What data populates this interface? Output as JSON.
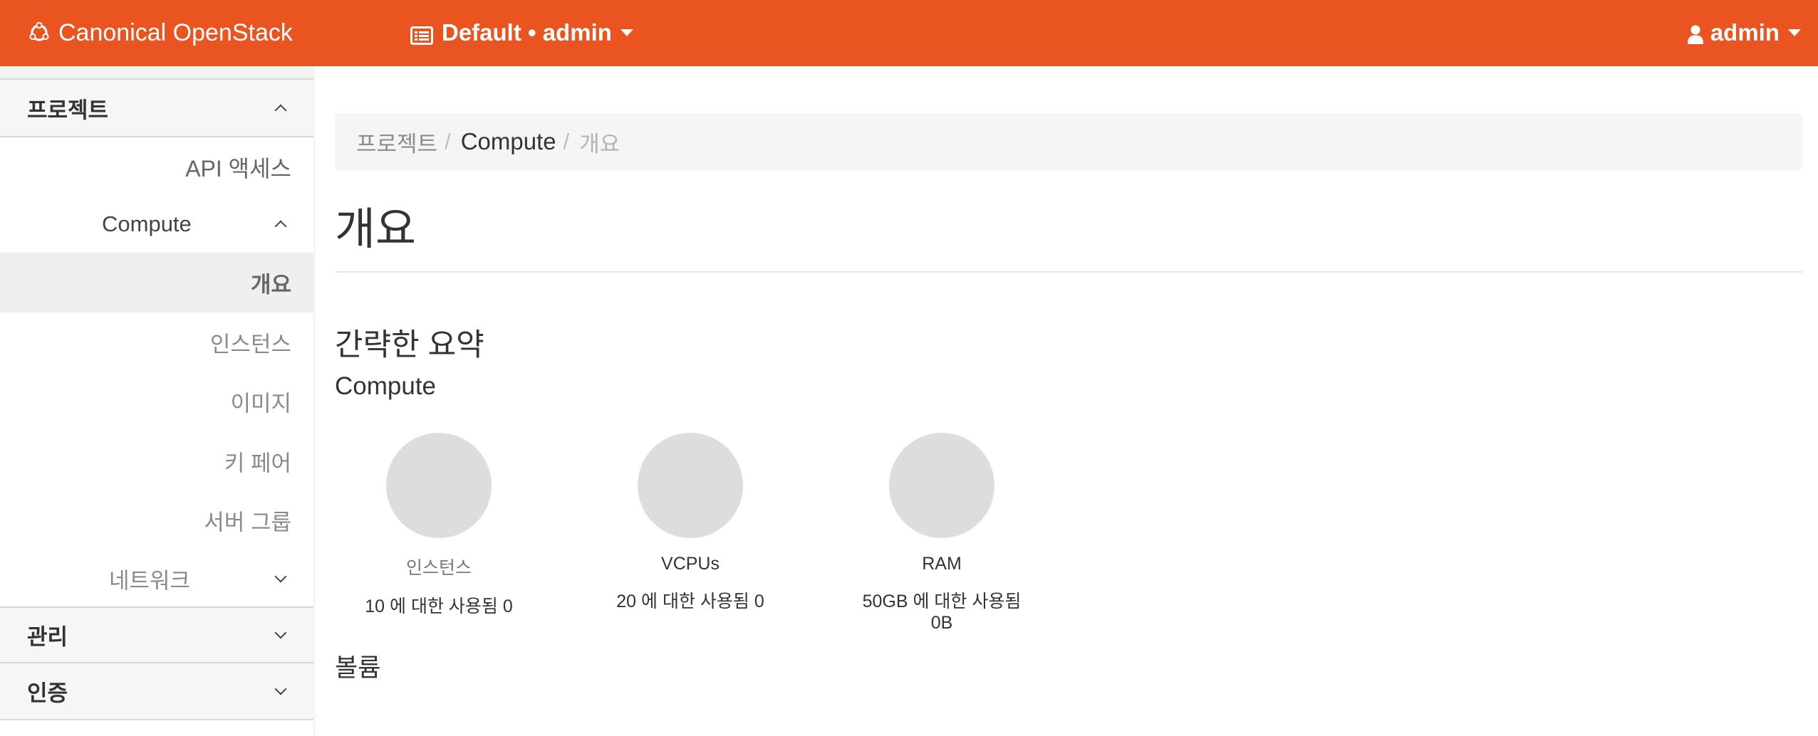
{
  "navbar": {
    "brand": "Canonical OpenStack",
    "project_selector": "Default • admin",
    "user_menu": "admin",
    "colors": {
      "background": "#E95420",
      "text": "#FFFFFF"
    },
    "icons": {
      "brand": "circle-of-friends-icon",
      "project": "list-icon",
      "user": "user-icon"
    }
  },
  "sidebar": {
    "panels": [
      {
        "label": "프로젝트",
        "expanded": true
      },
      {
        "label": "관리",
        "expanded": false
      },
      {
        "label": "인증",
        "expanded": false
      }
    ],
    "project_items": {
      "api_access": "API 액세스",
      "compute": "Compute",
      "compute_children": [
        "개요",
        "인스턴스",
        "이미지",
        "키 페어",
        "서버 그룹"
      ],
      "active": "개요",
      "network": "네트워크"
    }
  },
  "breadcrumb": [
    "프로젝트",
    "Compute",
    "개요"
  ],
  "page": {
    "title": "개요",
    "summary_heading": "간략한 요약",
    "compute_heading": "Compute",
    "volume_heading": "볼륨"
  },
  "usage_pies": [
    {
      "title": "인스턴스",
      "usage": "10 에 대한 사용됨 0",
      "used": 0,
      "limit": 10
    },
    {
      "title": "VCPUs",
      "usage": "20 에 대한 사용됨 0",
      "used": 0,
      "limit": 20
    },
    {
      "title": "RAM",
      "usage": "50GB 에 대한 사용됨 0B",
      "used": 0,
      "limit": 50
    }
  ]
}
